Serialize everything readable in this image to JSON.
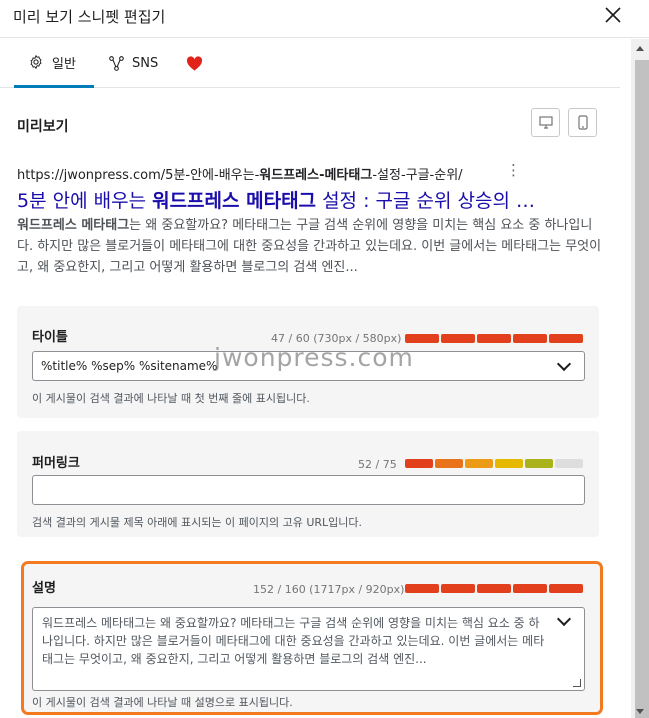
{
  "modal": {
    "title": "미리 보기 스니펫 편집기",
    "close_icon": "close-icon"
  },
  "tabs": [
    {
      "label": "일반",
      "icon": "gear-icon",
      "active": true
    },
    {
      "label": "SNS",
      "icon": "share-nodes-icon",
      "active": false
    },
    {
      "label": "",
      "icon": "heart-icon",
      "active": false
    }
  ],
  "preview": {
    "label": "미리보기",
    "url": "https://jwonpress.com/5분-안에-배우는-워드프레스-메타태그-설정-구글-순위/",
    "url_prefix": "https://jwonpress.com/5분-안에-배우는-",
    "url_bold": "워드프레스-메타태그",
    "url_suffix": "-설정-구글-순위/",
    "more_icon": "⋮",
    "title_prefix": "5분 안에 배우는 ",
    "title_bold": "워드프레스 메타태그",
    "title_suffix": " 설정 : 구글 순위 상승의 …",
    "desc_bold": "워드프레스 메타태그",
    "desc_rest": "는 왜 중요할까요? 메타태그는 구글 검색 순위에 영향을 미치는 핵심 요소 중 하나입니다. 하지만 많은 블로거들이 메타태그에 대한 중요성을 간과하고 있는데요. 이번 글에서는 메타태그는 무엇이고, 왜 중요한지, 그리고 어떻게 활용하면 블로그의 검색 엔진..."
  },
  "watermark": "jwonpress.com",
  "fields": {
    "title": {
      "label": "타이틀",
      "counter": "47 / 60 (730px / 580px)",
      "value": "%title% %sep% %sitename%",
      "help": "이 게시물이 검색 결과에 나타날 때 첫 번째 줄에 표시됩니다.",
      "meter_colors": [
        "#e2401c",
        "#e2401c",
        "#e2401c",
        "#e2401c",
        "#e2401c"
      ]
    },
    "permalink": {
      "label": "퍼머링크",
      "counter": "52 / 75",
      "value": "",
      "help": "검색 결과의 게시물 제목 아래에 표시되는 이 페이지의 고유 URL입니다.",
      "meter_colors": [
        "#e2401c",
        "#e9731a",
        "#eb9b16",
        "#e4b900",
        "#a9b21b",
        "#dddddd"
      ]
    },
    "description": {
      "label": "설명",
      "counter": "152 / 160 (1717px / 920px)",
      "value": "워드프레스 메타태그는 왜 중요할까요? 메타태그는 구글 검색 순위에 영향을 미치는 핵심 요소 중 하나입니다. 하지만 많은 블로거들이 메타태그에 대한 중요성을 간과하고 있는데요. 이번 글에서는 메타태그는 무엇이고, 왜 중요한지, 그리고 어떻게 활용하면 블로그의 검색 엔진...",
      "help": "이 게시물이 검색 결과에 나타날 때 설명으로 표시됩니다.",
      "meter_colors": [
        "#e2401c",
        "#e2401c",
        "#e2401c",
        "#e2401c",
        "#e2401c"
      ]
    }
  },
  "colors": {
    "accent": "#007cba",
    "link_title": "#1a0dab",
    "highlight": "#f47a20"
  }
}
